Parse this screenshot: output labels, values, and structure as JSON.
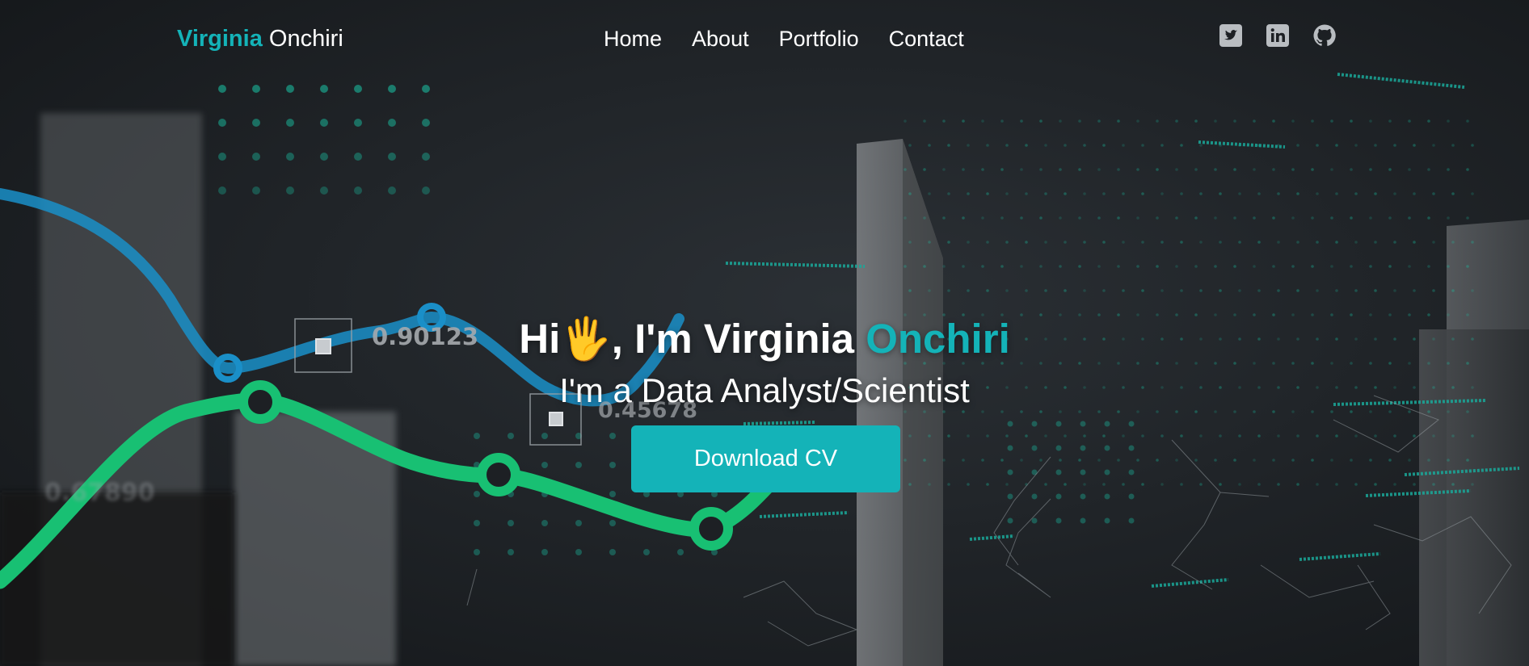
{
  "brand": {
    "first": "Virginia",
    "last": "Onchiri"
  },
  "nav": {
    "items": [
      {
        "label": "Home"
      },
      {
        "label": "About"
      },
      {
        "label": "Portfolio"
      },
      {
        "label": "Contact"
      }
    ]
  },
  "social": {
    "icons": [
      "twitter-icon",
      "linkedin-icon",
      "github-icon"
    ]
  },
  "hero": {
    "greeting": "Hi",
    "wave": "🖐",
    "intro": ", I'm Virginia ",
    "name_accent": "Onchiri",
    "subtitle": "I'm a Data Analyst/Scientist",
    "cta_label": "Download CV"
  },
  "background": {
    "labels": [
      "0.90123",
      "0.45678",
      "0.67890"
    ]
  },
  "colors": {
    "accent": "#14b3b8",
    "background": "#1d2024",
    "green_line": "#18c073",
    "blue_line": "#1a8fc8"
  }
}
